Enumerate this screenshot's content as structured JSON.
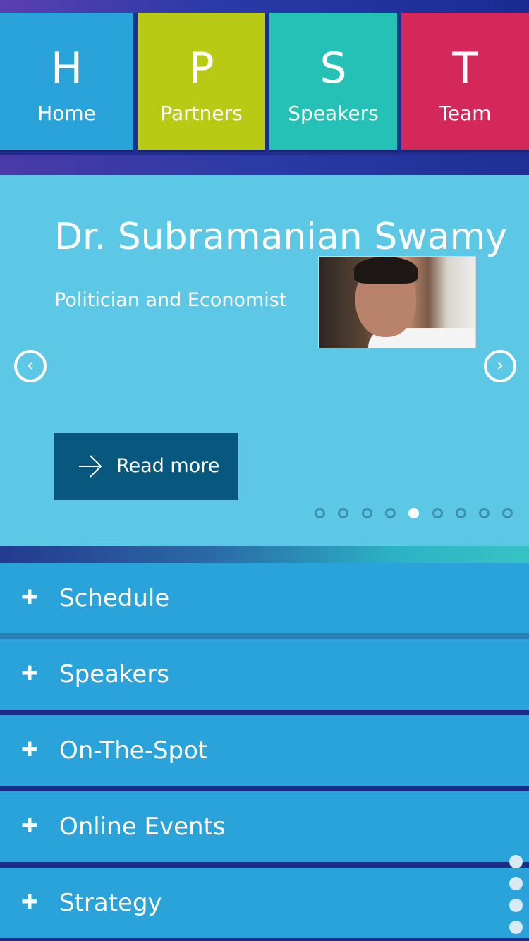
{
  "tiles": [
    {
      "letter": "H",
      "label": "Home",
      "color": "#2aa3da"
    },
    {
      "letter": "P",
      "label": "Partners",
      "color": "#b9ca15"
    },
    {
      "letter": "S",
      "label": "Speakers",
      "color": "#26c1b6"
    },
    {
      "letter": "T",
      "label": "Team",
      "color": "#d4285a"
    }
  ],
  "slider": {
    "name": "Dr. Subramanian Swamy",
    "title": "Politician and Economist",
    "read_more": "Read more",
    "prev_icon": "chevron-left-icon",
    "next_icon": "chevron-right-icon",
    "dot_count": 9,
    "active_dot": 5
  },
  "accordion": [
    {
      "icon": "plus-icon",
      "label": "Schedule"
    },
    {
      "icon": "plus-icon",
      "label": "Speakers"
    },
    {
      "icon": "plus-icon",
      "label": "On-The-Spot"
    },
    {
      "icon": "plus-icon",
      "label": "Online Events"
    },
    {
      "icon": "plus-icon",
      "label": "Strategy"
    }
  ],
  "colors": {
    "accent_blue": "#2aa3da",
    "slider_bg": "#5cc8e6",
    "button_bg": "#07577f",
    "dark_navy": "#1c2b86"
  }
}
